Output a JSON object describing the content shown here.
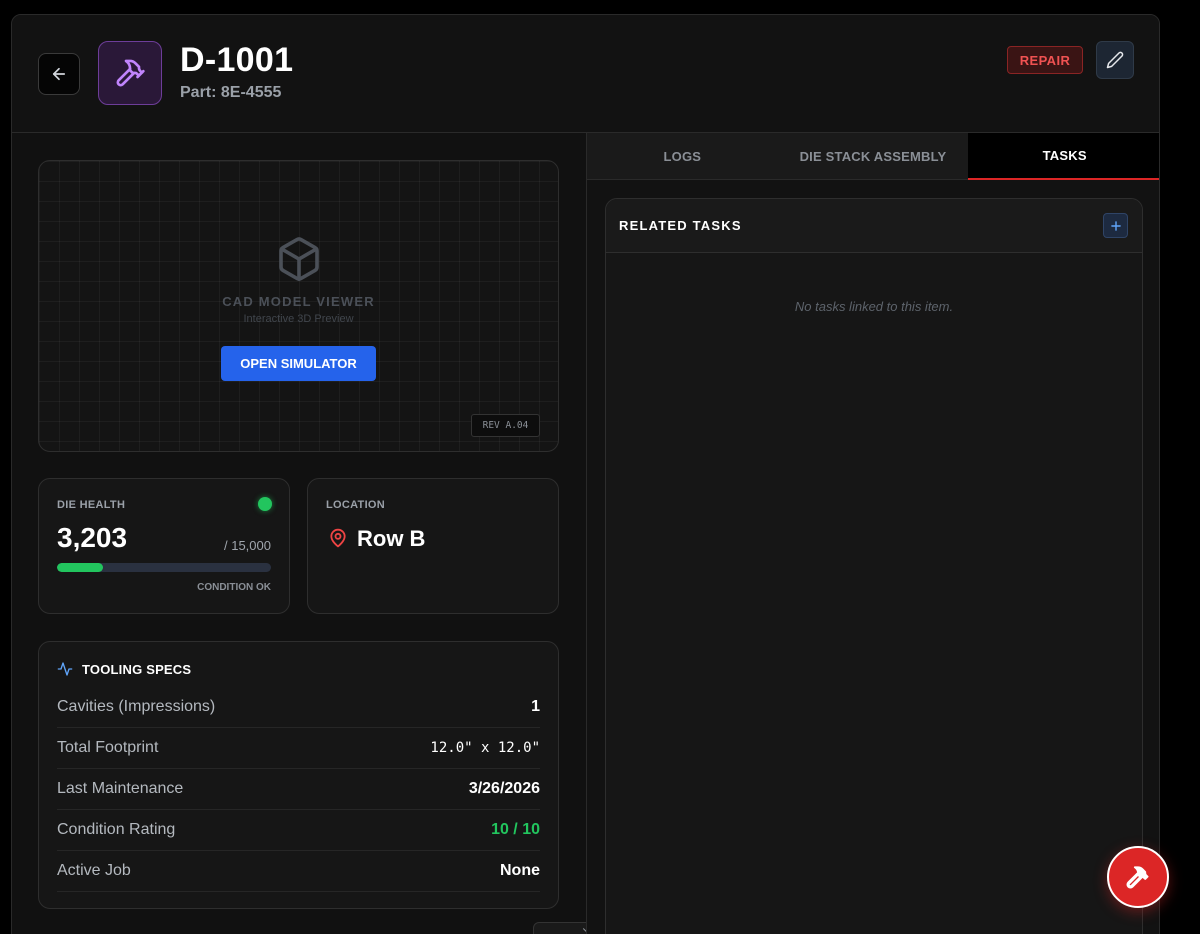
{
  "header": {
    "title": "D-1001",
    "part": "Part: 8E-4555",
    "status_badge": "REPAIR",
    "item_icon": "hammer-icon",
    "back_icon": "arrow-left-icon",
    "edit_icon": "pencil-icon"
  },
  "cad_viewer": {
    "title": "CAD MODEL VIEWER",
    "subtitle": "Interactive 3D Preview",
    "button_label": "OPEN SIMULATOR",
    "revision": "REV A.04",
    "icon": "cube-icon"
  },
  "die_health": {
    "label": "DIE HEALTH",
    "value": "3,203",
    "max": "/ 15,000",
    "fraction": 0.2135,
    "status": "CONDITION OK",
    "indicator_color": "#22c55e"
  },
  "location": {
    "label": "LOCATION",
    "value": "Row B",
    "icon": "map-pin-icon"
  },
  "specs": {
    "title": "TOOLING SPECS",
    "icon": "activity-icon",
    "rows": [
      {
        "label": "Cavities (Impressions)",
        "value": "1"
      },
      {
        "label": "Total Footprint",
        "value": "12.0\" x 12.0\""
      },
      {
        "label": "Last Maintenance",
        "value": "3/26/2026"
      },
      {
        "label": "Condition Rating",
        "value": "10 / 10"
      },
      {
        "label": "Active Job",
        "value": "None"
      }
    ]
  },
  "tabs": [
    {
      "label": "LOGS",
      "active": false
    },
    {
      "label": "DIE STACK ASSEMBLY",
      "active": false
    },
    {
      "label": "TASKS",
      "active": true
    }
  ],
  "tasks": {
    "title": "RELATED TASKS",
    "empty_message": "No tasks linked to this item.",
    "add_icon": "plus-icon"
  },
  "fab": {
    "icon": "hammer-icon"
  },
  "colors": {
    "accent_blue": "#2563eb",
    "accent_red": "#dc2626",
    "ok_green": "#22c55e",
    "purple": "#a855f7"
  }
}
